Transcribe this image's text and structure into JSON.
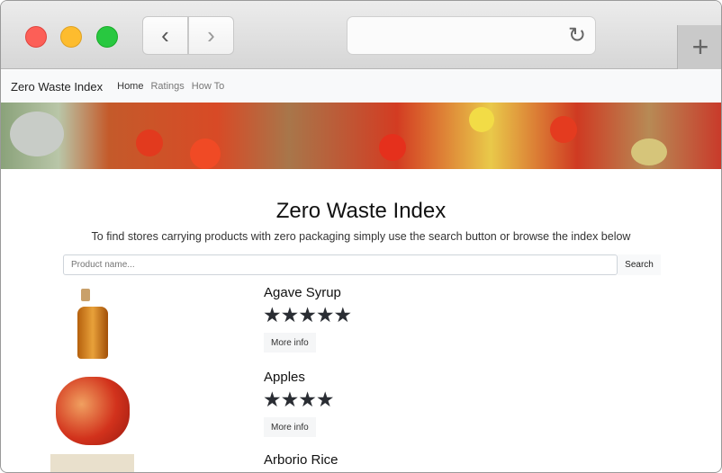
{
  "browser": {
    "back_icon": "chevron-left",
    "forward_icon": "chevron-right",
    "reload_icon": "reload",
    "new_tab_icon": "plus"
  },
  "nav": {
    "brand": "Zero Waste Index",
    "links": [
      "Home",
      "Ratings",
      "How To"
    ]
  },
  "main": {
    "title": "Zero Waste Index",
    "subtitle": "To find stores carrying products with zero packaging simply use the search button or browse the index below",
    "search_placeholder": "Product name...",
    "search_button": "Search"
  },
  "products": [
    {
      "name": "Agave Syrup",
      "rating": 5,
      "stars": "★★★★★",
      "button": "More info"
    },
    {
      "name": "Apples",
      "rating": 4,
      "stars": "★★★★",
      "button": "More info"
    },
    {
      "name": "Arborio Rice"
    }
  ]
}
